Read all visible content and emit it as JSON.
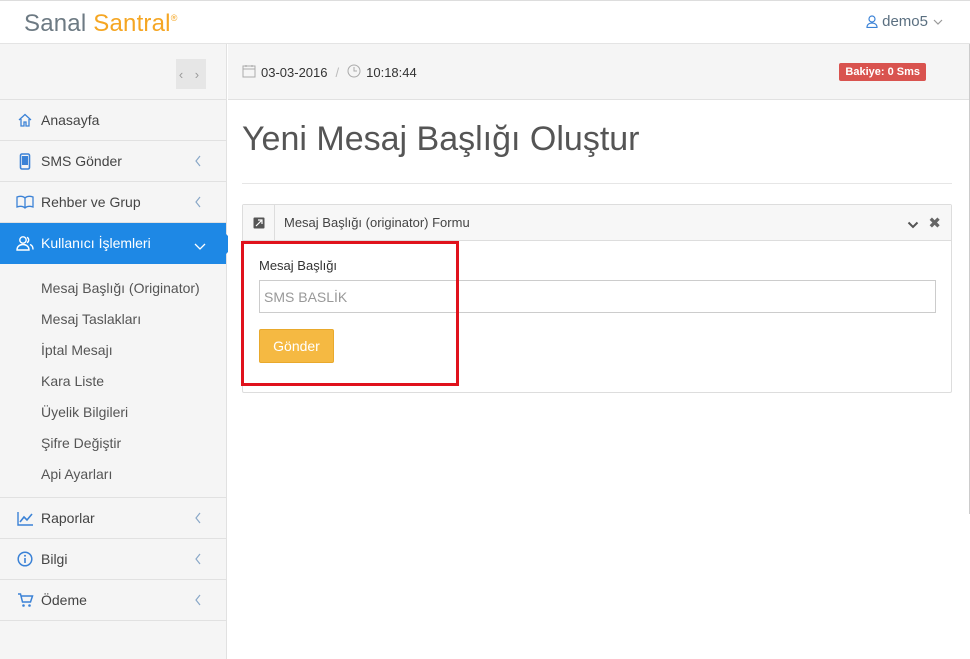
{
  "header": {
    "brand_part1": "Sanal",
    "brand_part2": "Santral",
    "brand_mark": "®",
    "username": "demo5"
  },
  "sidebar": {
    "toggle_label": "‹ ›",
    "items": [
      {
        "label": "Anasayfa",
        "icon": "home-icon"
      },
      {
        "label": "SMS Gönder",
        "icon": "mobile-icon"
      },
      {
        "label": "Rehber ve Grup",
        "icon": "book-icon"
      },
      {
        "label": "Kullanıcı İşlemleri",
        "icon": "users-icon"
      },
      {
        "label": "Raporlar",
        "icon": "chart-icon"
      },
      {
        "label": "Bilgi",
        "icon": "info-icon"
      },
      {
        "label": "Ödeme",
        "icon": "cart-icon"
      }
    ],
    "sub_items": [
      "Mesaj Başlığı (Originator)",
      "Mesaj Taslakları",
      "İptal Mesajı",
      "Kara Liste",
      "Üyelik Bilgileri",
      "Şifre Değiştir",
      "Api Ayarları"
    ]
  },
  "infobar": {
    "date": "03-03-2016",
    "separator": "/",
    "time": "10:18:44",
    "balance_badge": "Bakiye: 0 Sms"
  },
  "main": {
    "page_title": "Yeni Mesaj Başlığı Oluştur",
    "panel_title": "Mesaj Başlığı (originator) Formu",
    "field_label": "Mesaj Başlığı",
    "field_placeholder": "SMS BASLİK",
    "submit_label": "Gönder"
  },
  "colors": {
    "accent": "#1e88e5",
    "brand_orange": "#f5a623",
    "badge_red": "#d9534f",
    "button_orange": "#f5b942",
    "highlight_red": "#e0121c"
  }
}
